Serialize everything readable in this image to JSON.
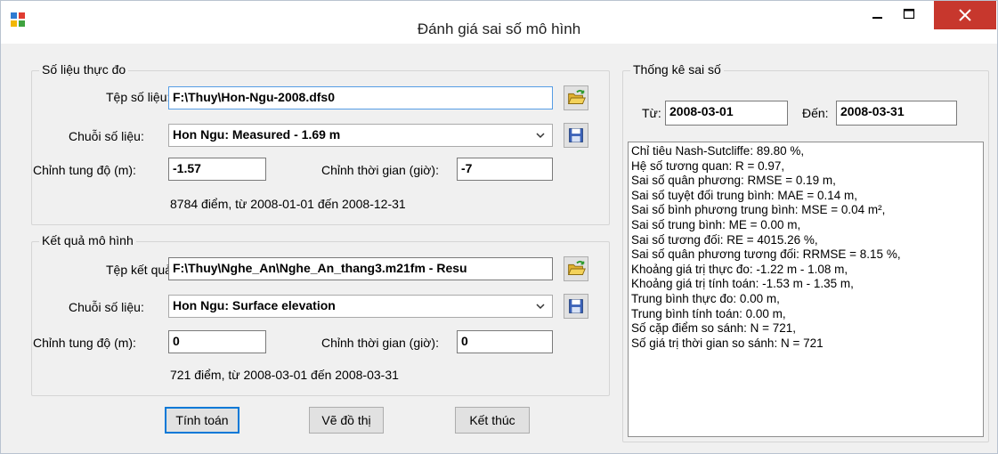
{
  "window": {
    "title": "Đánh giá sai số mô hình"
  },
  "measured": {
    "group_label": "Số liệu thực đo",
    "file_label": "Tệp số liệu:",
    "file_value": "F:\\Thuy\\Hon-Ngu-2008.dfs0",
    "series_label": "Chuỗi số liệu:",
    "series_value": "Hon Ngu: Measured - 1.69 m",
    "y_adjust_label": "Chỉnh tung độ (m):",
    "y_adjust_value": "-1.57",
    "t_adjust_label": "Chỉnh thời gian (giờ):",
    "t_adjust_value": "-7",
    "info": "8784 điểm, từ 2008-01-01 đến 2008-12-31"
  },
  "model": {
    "group_label": "Kết quả mô hình",
    "file_label": "Tệp kết quả:",
    "file_value": "F:\\Thuy\\Nghe_An\\Nghe_An_thang3.m21fm - Resu",
    "series_label": "Chuỗi số liệu:",
    "series_value": "Hon Ngu: Surface elevation",
    "y_adjust_label": "Chỉnh tung độ (m):",
    "y_adjust_value": "0",
    "t_adjust_label": "Chỉnh thời gian (giờ):",
    "t_adjust_value": "0",
    "info": "721 điểm, từ 2008-03-01 đến 2008-03-31"
  },
  "stats": {
    "group_label": "Thống kê sai số",
    "from_label": "Từ:",
    "from_value": "2008-03-01",
    "to_label": "Đến:",
    "to_value": "2008-03-31",
    "lines": [
      "Chỉ tiêu Nash-Sutcliffe: 89.80 %,",
      "Hệ số tương quan: R = 0.97,",
      "Sai số quân phương: RMSE = 0.19 m,",
      "Sai số tuyệt đối trung bình: MAE = 0.14 m,",
      "Sai số bình phương trung bình: MSE = 0.04 m²,",
      "Sai số trung bình: ME = 0.00 m,",
      "Sai số tương đối: RE = 4015.26 %,",
      "Sai số quân phương tương đối: RRMSE = 8.15 %,",
      "Khoảng giá trị thực đo: -1.22 m - 1.08 m,",
      "Khoảng giá trị tính toán: -1.53 m - 1.35 m,",
      "Trung bình thực đo: 0.00 m,",
      "Trung bình tính toán: 0.00 m,",
      "Số cặp điểm so sánh: N = 721,",
      "Số giá trị thời gian so sánh: N = 721"
    ]
  },
  "buttons": {
    "compute": "Tính toán",
    "plot": "Vẽ đồ thị",
    "exit": "Kết thúc"
  },
  "icons": {
    "app": "app-icon",
    "open": "folder-open-icon",
    "save": "save-disk-icon",
    "dropdown": "chevron-down-icon",
    "minimize": "minimize-icon",
    "maximize": "maximize-icon",
    "close": "close-icon"
  },
  "colors": {
    "close_button": "#c7372d",
    "focus_border": "#569de5",
    "default_button": "#0078d7"
  }
}
